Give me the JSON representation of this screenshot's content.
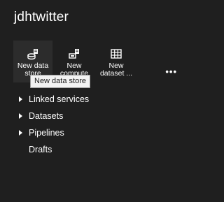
{
  "app": {
    "title": "jdhtwitter"
  },
  "toolbar": {
    "items": [
      {
        "name": "new-data-store-button",
        "label": "New data\nstore",
        "icon": "data-store-icon"
      },
      {
        "name": "new-compute-button",
        "label": "New\ncompute",
        "icon": "compute-icon"
      },
      {
        "name": "new-dataset-button",
        "label": "New\ndataset ...",
        "icon": "table-icon"
      }
    ],
    "more_label": "•••"
  },
  "tooltip": {
    "text": "New data store"
  },
  "tree": {
    "items": [
      {
        "label": "Linked services",
        "expandable": true
      },
      {
        "label": "Datasets",
        "expandable": true
      },
      {
        "label": "Pipelines",
        "expandable": true
      },
      {
        "label": "Drafts",
        "expandable": false
      }
    ]
  }
}
